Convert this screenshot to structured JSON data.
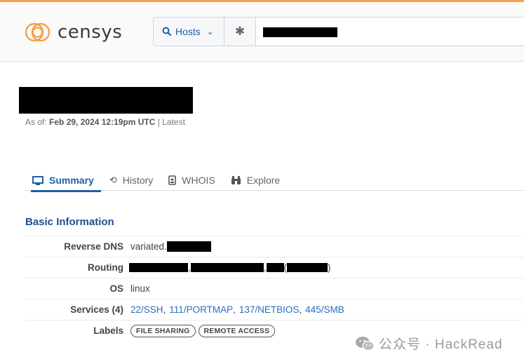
{
  "brand": {
    "name": "censys",
    "accent": "#f4a24a"
  },
  "search": {
    "type_label": "Hosts",
    "type_icon": "search-icon",
    "settings_icon": "gear-icon",
    "query": ""
  },
  "host": {
    "as_of_label": "As of:",
    "as_of_date": "Feb 29, 2024 12:19pm UTC",
    "as_of_suffix": "| Latest"
  },
  "tabs": [
    {
      "label": "Summary",
      "icon": "monitor-icon",
      "active": true
    },
    {
      "label": "History",
      "icon": "history-icon",
      "active": false
    },
    {
      "label": "WHOIS",
      "icon": "id-badge-icon",
      "active": false
    },
    {
      "label": "Explore",
      "icon": "binoculars-icon",
      "active": false
    }
  ],
  "basic_info": {
    "title": "Basic Information",
    "reverse_dns": {
      "label": "Reverse DNS",
      "value_prefix": "variated."
    },
    "routing": {
      "label": "Routing",
      "close_paren": ")"
    },
    "os": {
      "label": "OS",
      "value": "linux"
    },
    "services": {
      "label": "Services (4)",
      "items": [
        "22/SSH",
        "111/PORTMAP",
        "137/NETBIOS",
        "445/SMB"
      ]
    },
    "labels": {
      "label": "Labels",
      "items": [
        "FILE SHARING",
        "REMOTE ACCESS"
      ]
    }
  },
  "watermark": {
    "text": "公众号 · HackRead"
  },
  "colors": {
    "link": "#2a6fc0",
    "heading": "#1f4e8c",
    "redaction": "#000000"
  }
}
